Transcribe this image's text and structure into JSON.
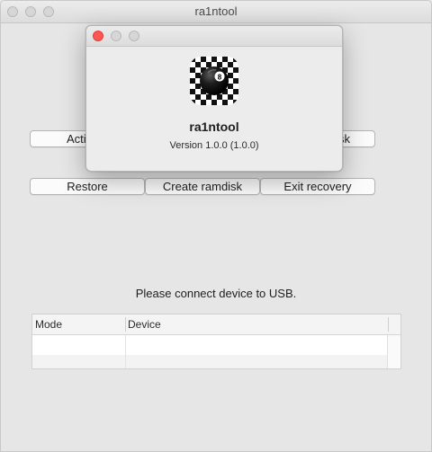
{
  "main_window": {
    "title": "ra1ntool",
    "buttons_row1": {
      "left_label": "Acti",
      "right_label": "sk"
    },
    "buttons_row2": [
      "Restore",
      "Create ramdisk",
      "Exit recovery"
    ],
    "status_text": "Please connect device to USB.",
    "table": {
      "columns": [
        "Mode",
        "Device"
      ],
      "rows": [
        [
          "",
          ""
        ],
        [
          "",
          ""
        ]
      ]
    }
  },
  "about_window": {
    "app_name": "ra1ntool",
    "version": "Version 1.0.0 (1.0.0)",
    "icon": "eight-ball-checkered-icon"
  },
  "colors": {
    "close_button": "#fc5753",
    "inactive_traffic": "#d6d6d6",
    "window_background": "#e6e6e6"
  }
}
